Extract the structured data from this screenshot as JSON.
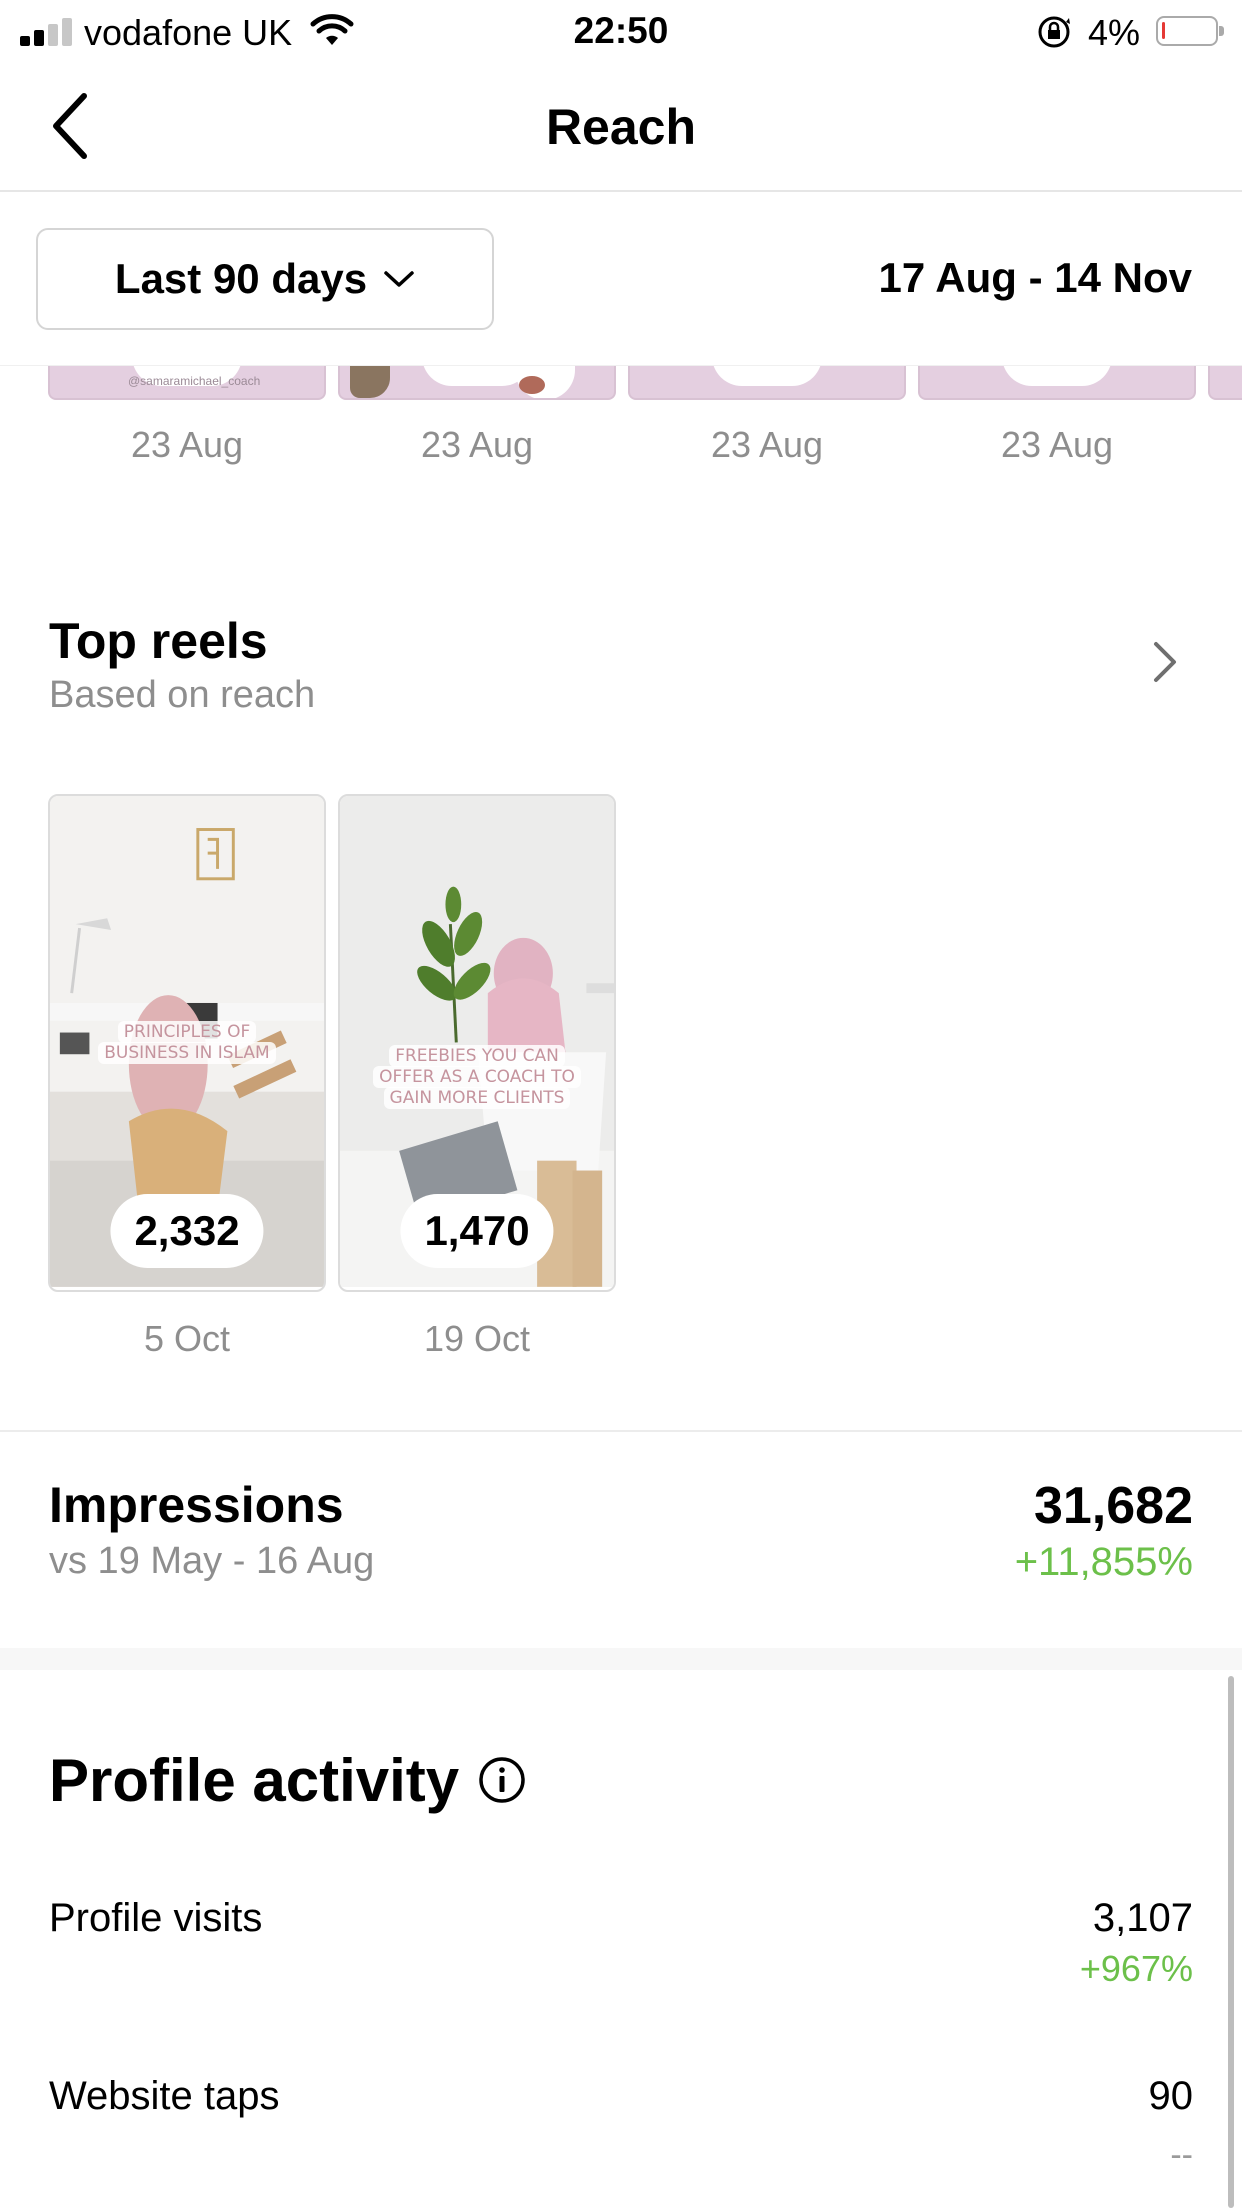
{
  "status_bar": {
    "carrier": "vodafone UK",
    "time": "22:50",
    "battery_percent": "4%",
    "signal_bars_active": 2,
    "signal_bars_total": 4,
    "battery_level": 0.04,
    "battery_color": "#e53935"
  },
  "nav": {
    "title": "Reach",
    "back_icon": "chevron-left-icon"
  },
  "filter": {
    "range_label": "Last 90 days",
    "date_range": "17 Aug - 14 Nov"
  },
  "stories": [
    {
      "date": "23 Aug",
      "handle": "@samaramichael_coach"
    },
    {
      "date": "23 Aug"
    },
    {
      "date": "23 Aug"
    },
    {
      "date": "23 Aug"
    }
  ],
  "top_reels": {
    "title": "Top reels",
    "subtitle": "Based on reach",
    "items": [
      {
        "caption_line1": "PRINCIPLES OF",
        "caption_line2": "BUSINESS IN ISLAM",
        "count": "2,332",
        "date": "5 Oct"
      },
      {
        "caption_line1": "FREEBIES YOU CAN",
        "caption_line2": "OFFER AS A COACH TO",
        "caption_line3": "GAIN MORE CLIENTS",
        "count": "1,470",
        "date": "19 Oct"
      }
    ]
  },
  "impressions": {
    "title": "Impressions",
    "comparison": "vs 19 May - 16 Aug",
    "value": "31,682",
    "change": "+11,855%"
  },
  "profile_activity": {
    "title": "Profile activity",
    "rows": [
      {
        "label": "Profile visits",
        "value": "3,107",
        "change": "+967%"
      },
      {
        "label": "Website taps",
        "value": "90",
        "change": "--"
      }
    ]
  },
  "colors": {
    "positive": "#6cc04a",
    "muted": "#8e8e8e",
    "story_bg": "#e4cfe0"
  }
}
